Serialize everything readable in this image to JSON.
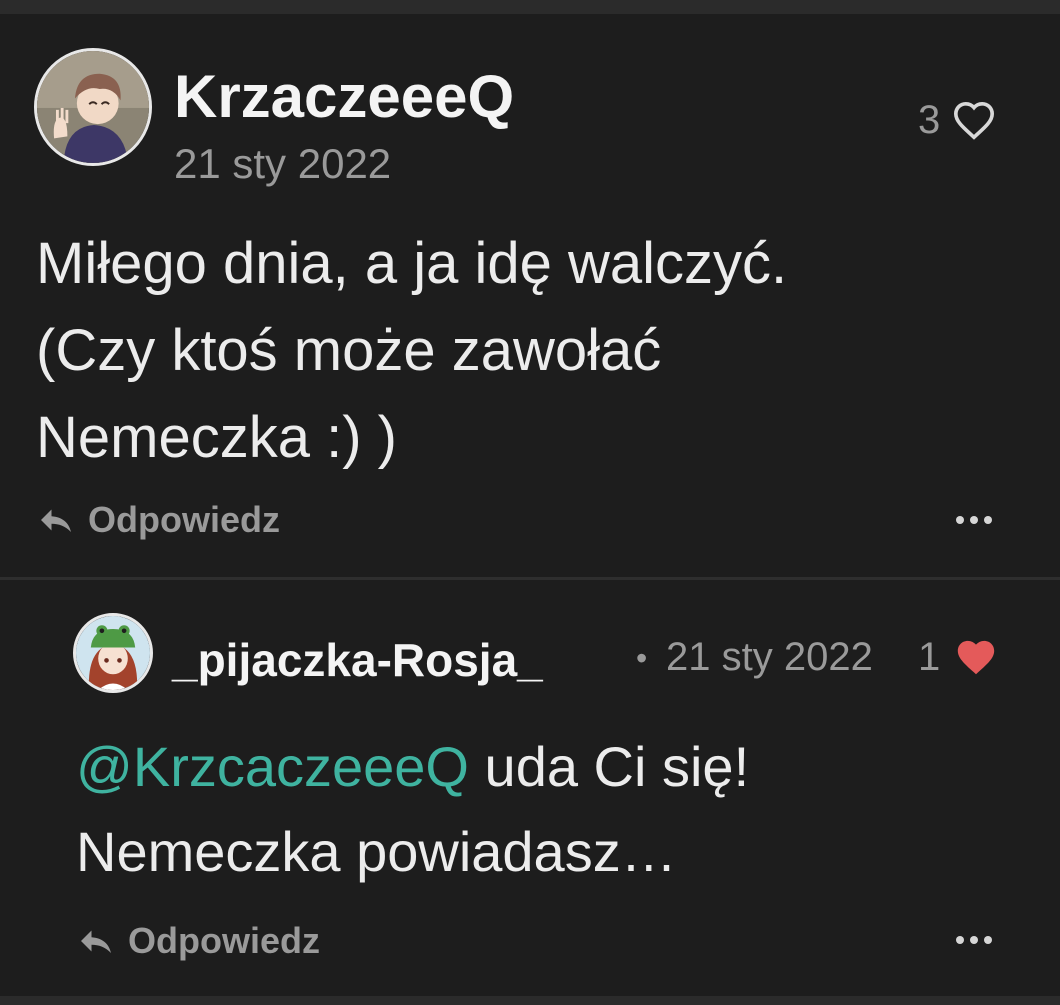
{
  "comments": [
    {
      "username": "KrzaczeeeQ",
      "date": "21 sty 2022",
      "likes": "3",
      "text_lines": [
        "Miłego dnia, a ja idę walczyć.",
        "(Czy ktoś może zawołać",
        "Nemeczka :) )"
      ],
      "reply_label": "Odpowiedz",
      "liked": false
    },
    {
      "username": "_pijaczka-Rosja_",
      "separator": "•",
      "date": "21 sty 2022",
      "likes": "1",
      "mention": "@KrzcaczeeeQ",
      "text_line1_rest": " uda Ci się!",
      "text_line2": "Nemeczka powiadasz…",
      "reply_label": "Odpowiedz",
      "liked": true
    }
  ],
  "colors": {
    "background": "#1d1d1d",
    "text": "#ececec",
    "muted": "#9a9a9a",
    "mention": "#3fb3a0",
    "liked_heart": "#e45a5a"
  },
  "icons": {
    "like": "heart-icon",
    "reply": "reply-arrow-icon",
    "more": "more-options-icon"
  }
}
